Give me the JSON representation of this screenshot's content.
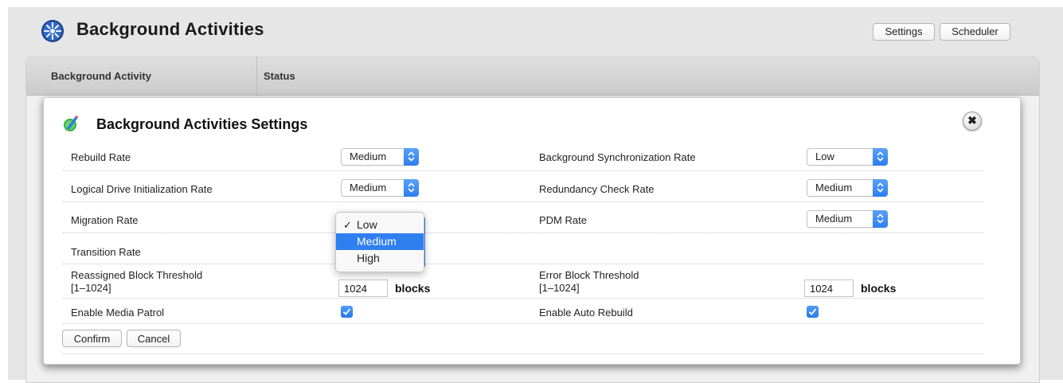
{
  "header": {
    "title": "Background Activities",
    "buttons": {
      "settings": "Settings",
      "scheduler": "Scheduler"
    },
    "logo_icon": "globe-icon"
  },
  "table": {
    "columns": [
      "Background Activity",
      "Status"
    ]
  },
  "dialog": {
    "title": "Background Activities Settings",
    "icon": "edit-pencil-icon",
    "close_icon": "close-icon",
    "left_rows": [
      {
        "label": "Rebuild Rate",
        "value": "Medium"
      },
      {
        "label": "Logical Drive Initialization Rate",
        "value": "Medium"
      },
      {
        "label": "Migration Rate",
        "value": "Low"
      },
      {
        "label": "Transition Rate",
        "value": ""
      }
    ],
    "right_rows": [
      {
        "label": "Background Synchronization Rate",
        "value": "Low"
      },
      {
        "label": "Redundancy Check Rate",
        "value": "Medium"
      },
      {
        "label": "PDM Rate",
        "value": "Medium"
      }
    ],
    "reassigned_threshold": {
      "label_line1": "Reassigned Block Threshold",
      "label_line2": "[1–1024]",
      "value": "1024",
      "unit": "blocks"
    },
    "error_threshold": {
      "label_line1": "Error Block Threshold",
      "label_line2": "[1–1024]",
      "value": "1024",
      "unit": "blocks"
    },
    "media_patrol": {
      "label": "Enable Media Patrol",
      "checked": true
    },
    "auto_rebuild": {
      "label": "Enable Auto Rebuild",
      "checked": true
    },
    "confirm_label": "Confirm",
    "cancel_label": "Cancel"
  },
  "dropdown_menu": {
    "options": [
      "Low",
      "Medium",
      "High"
    ],
    "checked": "Low",
    "highlighted": "Medium",
    "check_glyph": "✓"
  },
  "colors": {
    "accent": "#2f7ff0",
    "page_bg": "#e6e6e6"
  }
}
